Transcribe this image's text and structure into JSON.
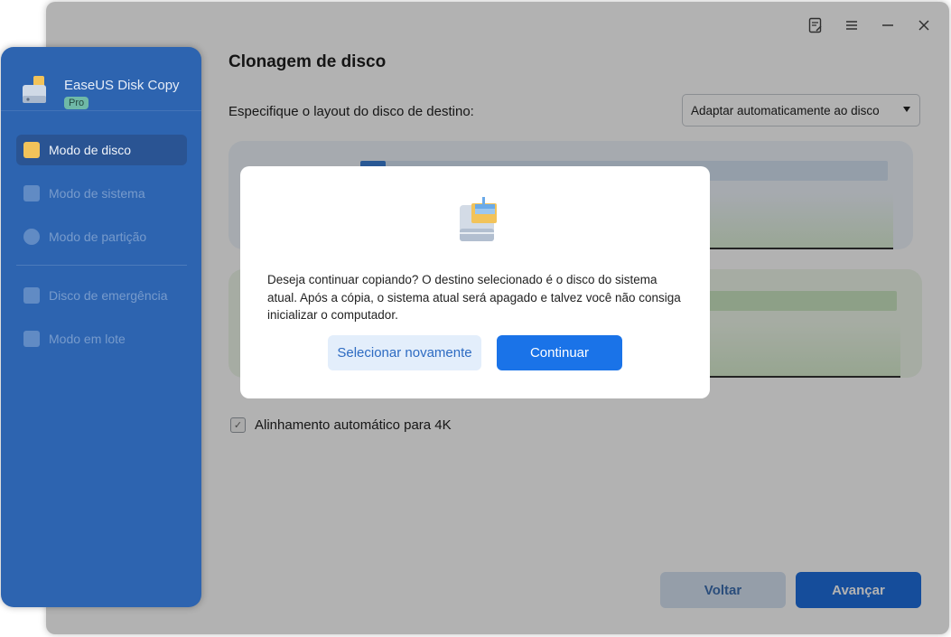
{
  "main": {
    "title": "Clonagem de disco",
    "layout_label": "Especifique o layout do disco de destino:",
    "layout_select_value": "Adaptar automaticamente ao disco",
    "align_4k_label": "Alinhamento automático para 4K",
    "align_4k_checked": true,
    "back_button": "Voltar",
    "next_button": "Avançar"
  },
  "sidebar": {
    "app_name": "EaseUS Disk Copy",
    "badge": "Pro",
    "items": [
      {
        "label": "Modo de disco",
        "icon": "disk-mode-icon",
        "active": true
      },
      {
        "label": "Modo de sistema",
        "icon": "windows-icon",
        "active": false
      },
      {
        "label": "Modo de partição",
        "icon": "pie-chart-icon",
        "active": false
      },
      {
        "label": "Disco de emergência",
        "icon": "emergency-disk-icon",
        "active": false
      },
      {
        "label": "Modo em lote",
        "icon": "batch-icon",
        "active": false
      }
    ]
  },
  "dialog": {
    "message": "Deseja continuar copiando? O destino selecionado é o disco do sistema atual. Após a cópia, o sistema atual será apagado e talvez você não consiga inicializar o computador.",
    "reselect_button": "Selecionar novamente",
    "continue_button": "Continuar"
  },
  "colors": {
    "accent": "#1a73e8",
    "sidebar": "#2d64b0"
  }
}
